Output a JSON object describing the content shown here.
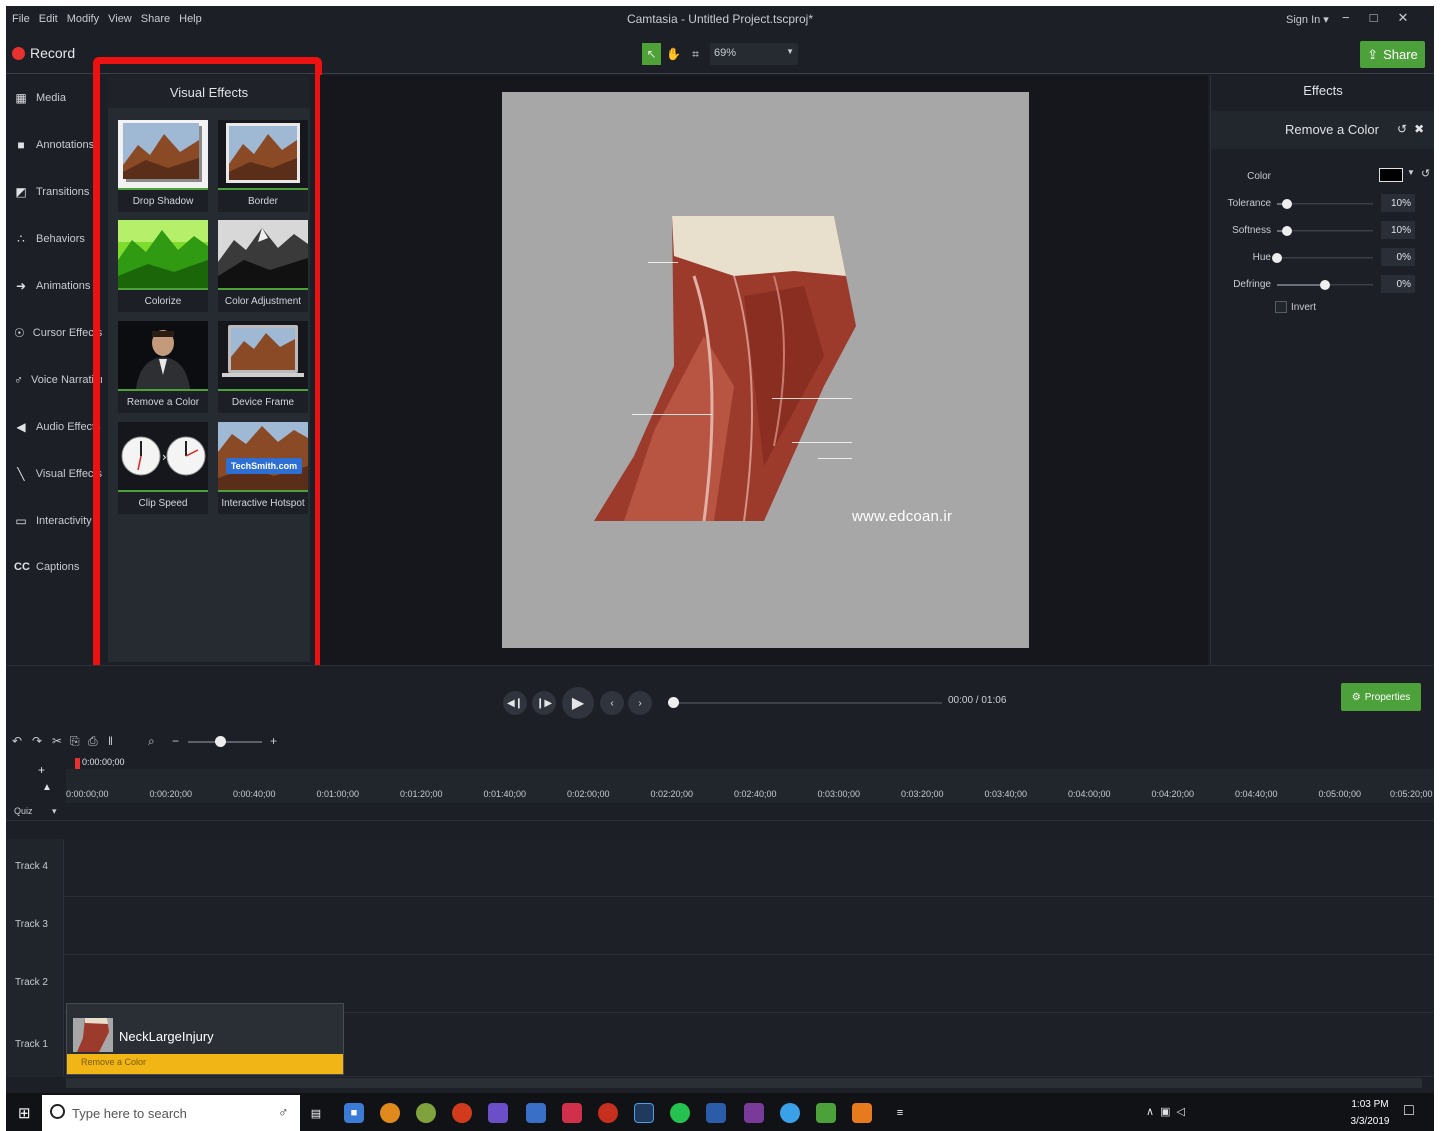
{
  "window": {
    "title": "Camtasia - Untitled Project.tscproj*",
    "menu": [
      "File",
      "Edit",
      "Modify",
      "View",
      "Share",
      "Help"
    ],
    "sign_in": "Sign In ▾",
    "controls": [
      "−",
      "□",
      "✕"
    ]
  },
  "toolbar": {
    "record_label": "Record",
    "zoom_value": "69%",
    "share_label": "Share"
  },
  "sidebar": {
    "items": [
      {
        "label": "Media",
        "icon": "film-icon"
      },
      {
        "label": "Annotations",
        "icon": "callout-icon"
      },
      {
        "label": "Transitions",
        "icon": "transition-icon"
      },
      {
        "label": "Behaviors",
        "icon": "behaviors-icon"
      },
      {
        "label": "Animations",
        "icon": "arrow-icon"
      },
      {
        "label": "Cursor Effects",
        "icon": "cursor-icon"
      },
      {
        "label": "Voice Narration",
        "icon": "microphone-icon"
      },
      {
        "label": "Audio Effects",
        "icon": "speaker-icon"
      },
      {
        "label": "Visual Effects",
        "icon": "magic-wand-icon"
      },
      {
        "label": "Interactivity",
        "icon": "interactivity-icon"
      },
      {
        "label": "Captions",
        "icon": "cc-icon"
      }
    ]
  },
  "visual_effects": {
    "title": "Visual Effects",
    "tiles": [
      {
        "label": "Drop Shadow"
      },
      {
        "label": "Border"
      },
      {
        "label": "Colorize"
      },
      {
        "label": "Color Adjustment"
      },
      {
        "label": "Remove a Color"
      },
      {
        "label": "Device Frame"
      },
      {
        "label": "Clip Speed"
      },
      {
        "label": "Interactive Hotspot"
      }
    ],
    "hotspot_text": "TechSmith.com"
  },
  "canvas": {
    "watermark": "www.edcoan.ir"
  },
  "properties": {
    "title": "Effects",
    "effect_name": "Remove a Color",
    "color_label": "Color",
    "color_value": "#000000",
    "tolerance": {
      "label": "Tolerance",
      "value": "10%"
    },
    "softness": {
      "label": "Softness",
      "value": "10%"
    },
    "hue": {
      "label": "Hue",
      "value": "0%"
    },
    "defringe": {
      "label": "Defringe",
      "value": "0%"
    },
    "invert_label": "Invert"
  },
  "playback": {
    "time": "00:00 / 01:06",
    "properties_label": "Properties"
  },
  "timeline": {
    "playhead_time": "0:00:00;00",
    "ticks": [
      "0:00:00;00",
      "0:00:20;00",
      "0:00:40;00",
      "0:01:00;00",
      "0:01:20;00",
      "0:01:40;00",
      "0:02:00;00",
      "0:02:20;00",
      "0:02:40;00",
      "0:03:00;00",
      "0:03:20;00",
      "0:03:40;00",
      "0:04:00;00",
      "0:04:20;00",
      "0:04:40;00",
      "0:05:00;00",
      "0:05:20;00"
    ],
    "quiz_label": "Quiz",
    "tracks": [
      "Track 4",
      "Track 3",
      "Track 2",
      "Track 1"
    ],
    "clip_name": "NeckLargeInjury",
    "clip_effect": "Remove a Color"
  },
  "taskbar": {
    "search_placeholder": "Type here to search",
    "time": "1:03 PM",
    "date": "3/3/2019"
  }
}
